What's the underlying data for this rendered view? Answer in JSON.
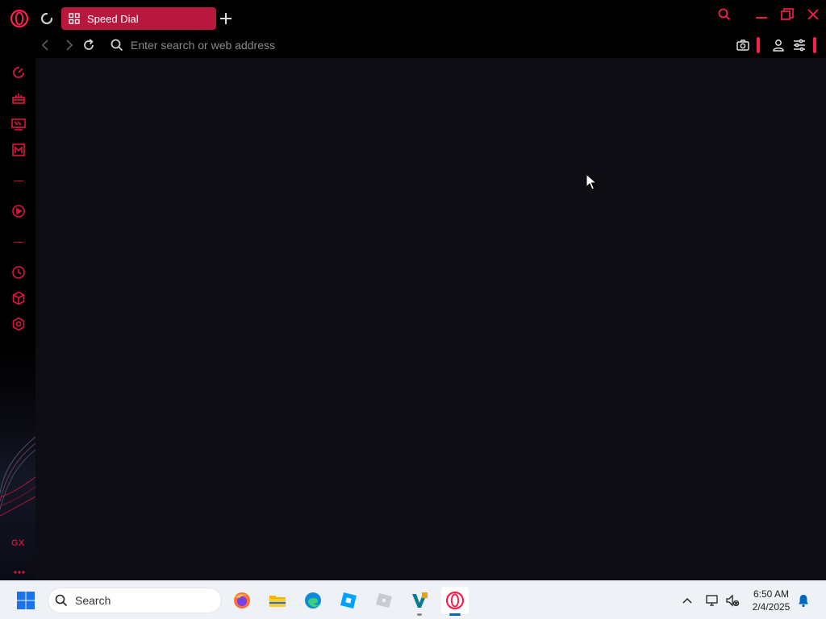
{
  "browser": {
    "name": "Opera GX",
    "accent_color": "#ff1f4e",
    "tab": {
      "label": "Speed Dial",
      "active": true,
      "color": "#b8173e"
    },
    "address_bar": {
      "placeholder": "Enter search or web address",
      "value": ""
    },
    "sidebar": {
      "items": [
        "speed-dial-icon",
        "gx-corner-icon",
        "twitch-icon",
        "gmail-icon",
        "player-icon",
        "history-icon",
        "extensions-icon",
        "settings-icon"
      ],
      "footer_label": "GX"
    }
  },
  "taskbar": {
    "search_label": "Search",
    "apps": [
      "firefox",
      "file-explorer",
      "edge",
      "roblox-studio",
      "roblox",
      "visual-studio-code",
      "opera-gx"
    ],
    "clock": {
      "time": "6:50 AM",
      "date": "2/4/2025"
    }
  }
}
